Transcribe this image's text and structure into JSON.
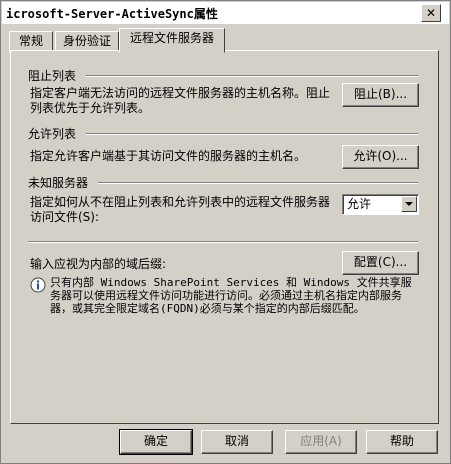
{
  "window": {
    "title": "icrosoft-Server-ActiveSync属性",
    "close_glyph": "✕"
  },
  "tabs": [
    {
      "label": "常规"
    },
    {
      "label": "身份验证"
    },
    {
      "label": "远程文件服务器"
    }
  ],
  "block_list": {
    "header": "阻止列表",
    "description": "指定客户端无法访问的远程文件服务器的主机名称。阻止列表优先于允许列表。",
    "button": "阻止(B)..."
  },
  "allow_list": {
    "header": "允许列表",
    "description": "指定允许客户端基于其访问文件的服务器的主机名。",
    "button": "允许(O)..."
  },
  "unknown_servers": {
    "header": "未知服务器",
    "description": "指定如何从不在阻止列表和允许列表中的远程文件服务器访问文件(S):",
    "selected": "允许"
  },
  "internal_domains": {
    "label": "输入应视为内部的域后缀:",
    "button": "配置(C)...",
    "note": "只有内部 Windows SharePoint Services 和 Windows 文件共享服务器可以使用远程文件访问功能进行访问。必须通过主机名指定内部服务器，或其完全限定域名(FQDN)必须与某个指定的内部后缀匹配。",
    "icon": "info-icon"
  },
  "footer": {
    "ok": "确定",
    "cancel": "取消",
    "apply": "应用(A)",
    "help": "帮助"
  }
}
